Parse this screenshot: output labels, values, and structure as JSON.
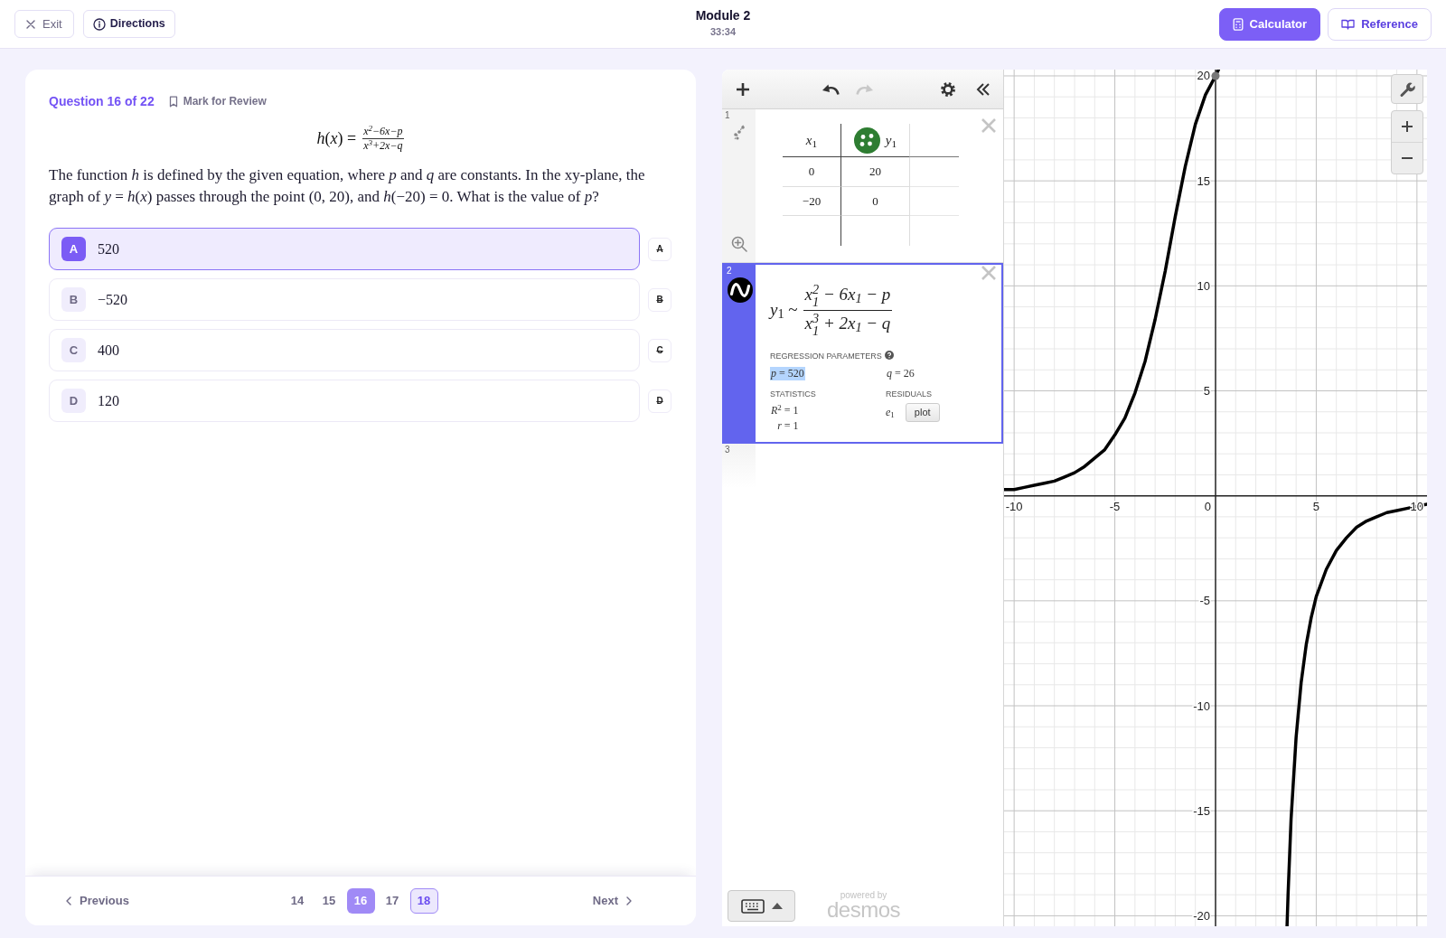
{
  "top_bar": {
    "exit_button": "Exit",
    "directions_button": "Directions",
    "title": "Module 2",
    "timer": "33:34",
    "tool_buttons": [
      {
        "label": "Calculator",
        "selected": true
      },
      {
        "label": "Reference",
        "selected": false
      }
    ]
  },
  "question": {
    "number": "Question 16 of 22",
    "mark_for_review": "Mark for Review",
    "equation": {
      "lhs": "*h*(*x*) =",
      "numerator": "x$^{2}$−6x−p",
      "denominator": "x$^{3}$+2x−q"
    },
    "text": "The function *h* is defined by the given equation, where *p* and *q* are constants. In the xy-plane, the graph of *y* = *h*(*x*) passes through the point (0, 20), and *h*(−20) = 0. What is the value of *p*?",
    "choices": [
      {
        "letter": "A",
        "answer": "520",
        "strike_label": "A",
        "selected": true
      },
      {
        "letter": "B",
        "answer": "−520",
        "strike_label": "B",
        "selected": false
      },
      {
        "letter": "C",
        "answer": "400",
        "strike_label": "C",
        "selected": false
      },
      {
        "letter": "D",
        "answer": "120",
        "strike_label": "D",
        "selected": false
      }
    ]
  },
  "navigation": {
    "previous": "Previous",
    "next": "Next",
    "pages": [
      {
        "label": "14",
        "selected": false,
        "highlighted": false
      },
      {
        "label": "15",
        "selected": false,
        "highlighted": false
      },
      {
        "label": "16",
        "selected": true,
        "highlighted": false
      },
      {
        "label": "17",
        "selected": false,
        "highlighted": false
      },
      {
        "label": "18",
        "selected": false,
        "highlighted": true
      }
    ]
  },
  "calculator": {
    "toolbar": {
      "undo_disabled": false,
      "redo_disabled": true
    },
    "expressions": [
      {
        "kind": "table",
        "number": "1",
        "selected": false,
        "columns": [
          "*x*$_{1}$",
          "*y*$_{1}$"
        ],
        "rows": [
          [
            "0",
            "20"
          ],
          [
            "−20",
            "0"
          ]
        ]
      },
      {
        "kind": "regression",
        "number": "2",
        "selected": true,
        "lhs": "*y*$_{1}$ ~",
        "numerator": "x$_{1}$$^{2}$ − 6x$_{1}$ − p",
        "denominator": "x$_{1}$$^{3}$ + 2x$_{1}$ − q",
        "parameters_label": "REGRESSION PARAMETERS",
        "parameters": [
          {
            "text": "*p* = 520",
            "highlighted": true
          },
          {
            "text": "*q* = 26",
            "highlighted": false
          }
        ],
        "statistics_label": "STATISTICS",
        "statistics": [
          "*R*$^{2}$ = 1",
          "*r* = 1"
        ],
        "residuals_label": "RESIDUALS",
        "residual": "*e*$_{1}$",
        "plot_button": "plot"
      },
      {
        "kind": "empty",
        "number": "3",
        "selected": false
      }
    ],
    "powered_by": "powered by",
    "logo": "desmos",
    "graph": {
      "chart_data": {
        "type": "line",
        "grid": true,
        "x": [
          -10.5,
          -10,
          -9.5,
          -9,
          -8.5,
          -8,
          -7.5,
          -7,
          -6.5,
          -6,
          -5.5,
          -5,
          -4.5,
          -4,
          -3.5,
          -3,
          -2.5,
          -2,
          -1.5,
          -1,
          -0.5,
          0,
          0.15,
          2.74,
          3.55,
          3.6,
          3.75,
          4,
          4.25,
          4.5,
          4.75,
          5,
          5.5,
          6,
          6.5,
          7,
          7.5,
          8,
          8.5,
          9,
          9.5,
          10,
          10.5
        ],
        "series": [
          {
            "color": "#000000",
            "values": [
              0.3,
              0.3,
              0.4,
              0.5,
              0.6,
              0.7,
              0.9,
              1.1,
              1.4,
              1.8,
              2.2,
              2.9,
              3.7,
              4.9,
              6.4,
              8.4,
              10.7,
              13.3,
              15.7,
              17.7,
              19.1,
              20,
              20.3,
              null,
              -20.5,
              -19,
              -15.4,
              -11.5,
              -8.9,
              -7.1,
              -5.8,
              -4.8,
              -3.5,
              -2.6,
              -2,
              -1.5,
              -1.2,
              -1,
              -0.8,
              -0.7,
              -0.6,
              -0.5,
              -0.4
            ]
          }
        ],
        "xlim": [
          -10.5,
          10.5
        ],
        "ylim": [
          -20.5,
          20.3
        ],
        "xticks": [
          {
            "value": -10,
            "label": "-10"
          },
          {
            "value": -5,
            "label": "-5"
          },
          {
            "value": 0,
            "label": "0"
          },
          {
            "value": 5,
            "label": "5"
          },
          {
            "value": 10,
            "label": "10"
          }
        ],
        "yticks": [
          {
            "value": -20,
            "label": "-20"
          },
          {
            "value": -15,
            "label": "-15"
          },
          {
            "value": -10,
            "label": "-10"
          },
          {
            "value": -5,
            "label": "-5"
          },
          {
            "value": 5,
            "label": "5"
          },
          {
            "value": 10,
            "label": "10"
          },
          {
            "value": 15,
            "label": "15"
          },
          {
            "value": 20,
            "label": "20"
          }
        ]
      }
    }
  }
}
